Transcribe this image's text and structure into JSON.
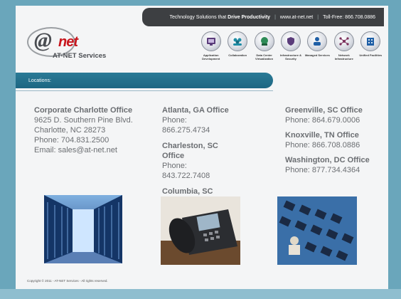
{
  "header": {
    "tagline_prefix": "Technology Solutions that",
    "tagline_bold": "Drive Productivity",
    "website": "www.at-net.net",
    "tollfree": "Toll-Free: 866.708.0886"
  },
  "logo": {
    "at": "@",
    "net": "net",
    "subtitle": "AT-NET Services"
  },
  "services": [
    {
      "label": "Application Development",
      "icon": "application-icon",
      "color": "#5a3c7a"
    },
    {
      "label": "Collaboration",
      "icon": "collaboration-icon",
      "color": "#1e8ca5"
    },
    {
      "label": "Data Center Virtualization",
      "icon": "data-center-icon",
      "color": "#2e8b57"
    },
    {
      "label": "Infrastructure & Security",
      "icon": "infrastructure-icon",
      "color": "#5a3c7a"
    },
    {
      "label": "Managed Services",
      "icon": "managed-services-icon",
      "color": "#1f5fa6"
    },
    {
      "label": "Network Infrastructure",
      "icon": "network-icon",
      "color": "#7a2e5a"
    },
    {
      "label": "Unified Facilities",
      "icon": "unified-facilities-icon",
      "color": "#1f5fa6"
    }
  ],
  "locations_label": "Locations:",
  "offices": {
    "charlotte": {
      "name": "Corporate Charlotte Office",
      "lines": [
        "9625 D. Southern Pine Blvd.",
        "Charlotte, NC 28273",
        "Phone: 704.831.2500",
        "Email: sales@at-net.net"
      ]
    },
    "atlanta": {
      "name": "Atlanta, GA Office",
      "phone": "Phone: 866.275.4734"
    },
    "charleston": {
      "name": "Charleston, SC Office",
      "phone": "Phone: 843.722.7408"
    },
    "columbia": {
      "name": "Columbia, SC"
    },
    "greenville": {
      "name": "Greenville, SC Office",
      "phone": "Phone: 864.679.0006"
    },
    "knoxville": {
      "name": "Knoxville, TN Office",
      "phone": "Phone: 866.708.0886"
    },
    "washington": {
      "name": "Washington, DC Office",
      "phone": "Phone: 877.734.4364"
    }
  },
  "copyright": "Copyright © 2011 - AT-NET Services - All rights reserved."
}
